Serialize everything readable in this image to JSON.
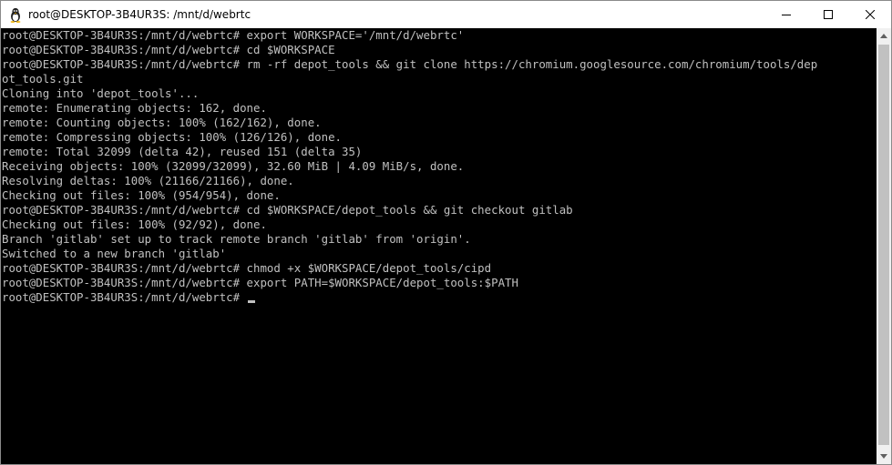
{
  "window": {
    "title": "root@DESKTOP-3B4UR3S: /mnt/d/webrtc",
    "app_icon": "linux-tux-icon",
    "buttons": {
      "minimize": "minimize-icon",
      "maximize": "maximize-icon",
      "close": "close-icon"
    }
  },
  "terminal": {
    "lines": [
      "root@DESKTOP-3B4UR3S:/mnt/d/webrtc# export WORKSPACE='/mnt/d/webrtc'",
      "root@DESKTOP-3B4UR3S:/mnt/d/webrtc# cd $WORKSPACE",
      "root@DESKTOP-3B4UR3S:/mnt/d/webrtc# rm -rf depot_tools && git clone https://chromium.googlesource.com/chromium/tools/dep",
      "ot_tools.git",
      "Cloning into 'depot_tools'...",
      "remote: Enumerating objects: 162, done.",
      "remote: Counting objects: 100% (162/162), done.",
      "remote: Compressing objects: 100% (126/126), done.",
      "remote: Total 32099 (delta 42), reused 151 (delta 35)",
      "Receiving objects: 100% (32099/32099), 32.60 MiB | 4.09 MiB/s, done.",
      "Resolving deltas: 100% (21166/21166), done.",
      "Checking out files: 100% (954/954), done.",
      "root@DESKTOP-3B4UR3S:/mnt/d/webrtc# cd $WORKSPACE/depot_tools && git checkout gitlab",
      "Checking out files: 100% (92/92), done.",
      "Branch 'gitlab' set up to track remote branch 'gitlab' from 'origin'.",
      "Switched to a new branch 'gitlab'",
      "root@DESKTOP-3B4UR3S:/mnt/d/webrtc# chmod +x $WORKSPACE/depot_tools/cipd",
      "root@DESKTOP-3B4UR3S:/mnt/d/webrtc# export PATH=$WORKSPACE/depot_tools:$PATH",
      "root@DESKTOP-3B4UR3S:/mnt/d/webrtc# "
    ]
  },
  "colors": {
    "background": "#000000",
    "foreground": "#c0c0c0",
    "titlebar": "#ffffff"
  }
}
